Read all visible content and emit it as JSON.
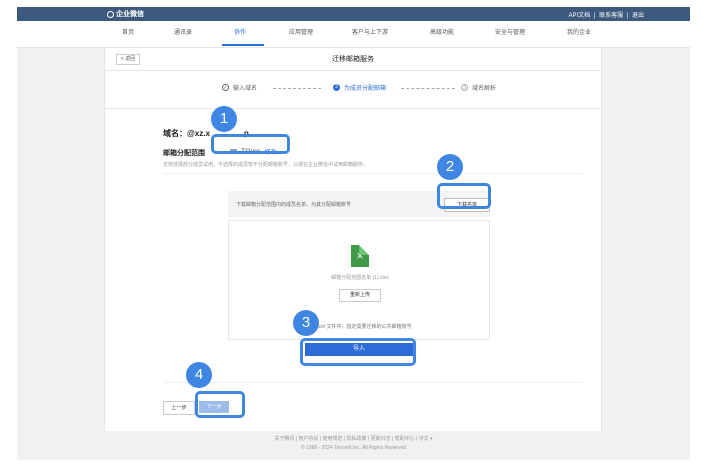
{
  "topbar": {
    "brand": "企业微信",
    "links": [
      "API文档",
      "|",
      "联系客服",
      "|",
      "退出"
    ]
  },
  "nav": {
    "items": [
      "首页",
      "通讯录",
      "协作",
      "应用管理",
      "客户与上下游",
      "高级功能",
      "安全与管理",
      "我的企业"
    ],
    "active_index": 2
  },
  "page": {
    "back": "< 返回",
    "title": "迁移邮箱服务",
    "steps": [
      {
        "num": "✓",
        "label": "输入域名",
        "state": "done"
      },
      {
        "num": "2",
        "label": "为成员分配邮箱",
        "state": "current"
      },
      {
        "num": "3",
        "label": "域名解析",
        "state": "todo"
      }
    ],
    "domain": "域名：@xz.x",
    "domain_suffix": "p",
    "scope_label": "邮箱分配范围",
    "scope_value": "721vce",
    "scope_edit": "修改",
    "hint": "支持选择部分成员试用，不选择的成员暂不分配邮箱账号，以便在企业微信中试用邮箱服务。",
    "download_bar_text": "下载邮箱分配范围内的成员名单，为其分配邮箱账号",
    "download_button": "下载名单",
    "file_name": "邮箱分配范围名单 (1).xlsx",
    "reupload": "重新上传",
    "excel_note": "在 Excel 文件中，指定需要迁移的公共邮箱账号",
    "import_button": "导入",
    "prev_button": "上一步",
    "next_button": "下一步"
  },
  "footer": {
    "links": "关于腾讯 | 用户协议 | 使用规范 | 隐私政策 | 更新日志 | 帮助中心 | 中文 ▾",
    "copyright": "© 1998 - 2024 Tencent Inc. All Rights Reserved"
  },
  "annotations": [
    "1",
    "2",
    "3",
    "4"
  ],
  "colors": {
    "accent": "#2d6bd6",
    "topbar": "#3c5a7d",
    "annotation": "#3f86e3",
    "excel": "#3e9b48"
  }
}
